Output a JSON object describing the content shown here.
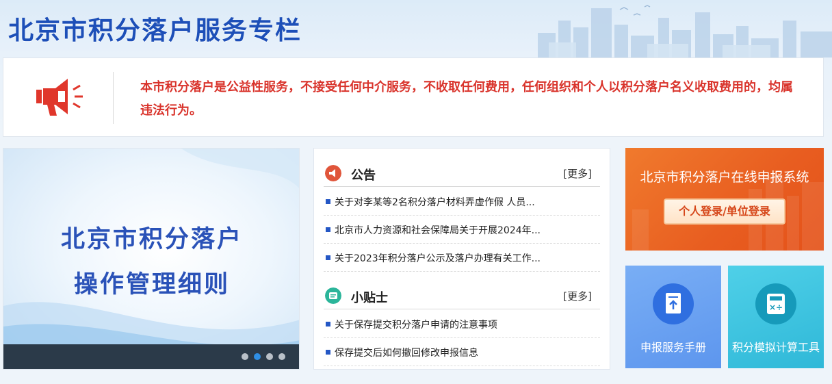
{
  "banner": {
    "title": "北京市积分落户服务专栏"
  },
  "notice": {
    "icon": "megaphone-icon",
    "text": "本市积分落户是公益性服务，不接受任何中介服务，不收取任何费用，任何组织和个人以积分落户名义收取费用的，均属违法行为。",
    "color": "#d9332b"
  },
  "carousel": {
    "line1": "北京市积分落户",
    "line2": "操作管理细则",
    "slide_count": 4,
    "active_slide": 2
  },
  "announcements": {
    "title": "公告",
    "more": "[更多]",
    "icon": "announcement-icon",
    "items": [
      "关于对李某等2名积分落户材料弄虚作假 人员...",
      "北京市人力资源和社会保障局关于开展2024年...",
      "关于2023年积分落户公示及落户办理有关工作..."
    ]
  },
  "tips": {
    "title": "小贴士",
    "more": "[更多]",
    "icon": "tips-icon",
    "items": [
      "关于保存提交积分落户申请的注意事项",
      "保存提交后如何撤回修改申报信息"
    ]
  },
  "online_system": {
    "title": "北京市积分落户在线申报系统",
    "login_button": "个人登录/单位登录",
    "color": "#e85d20"
  },
  "tiles": [
    {
      "label": "申报服务手册",
      "icon": "document-upload-icon",
      "color": "#5d96ee"
    },
    {
      "label": "积分模拟计算工具",
      "icon": "calculator-icon",
      "color": "#2fb8d8"
    }
  ]
}
